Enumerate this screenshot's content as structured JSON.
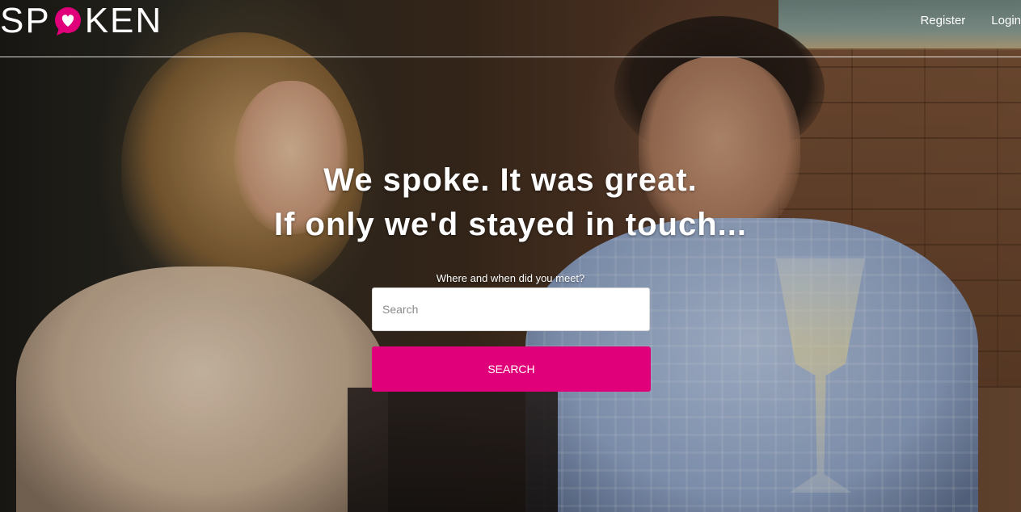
{
  "brand": {
    "logo_left": "SP",
    "logo_right": "KEN",
    "logo_text": "SPOKEN",
    "accent_color": "#e0007a"
  },
  "nav": {
    "register_label": "Register",
    "login_label": "Login"
  },
  "hero": {
    "title_line1": "We spoke. It was great.",
    "title_line2": "If only we'd stayed in touch...",
    "background_image": "photo-of-couple-with-wine-glasses"
  },
  "search": {
    "label": "Where and when did you meet?",
    "placeholder": "Search",
    "value": "",
    "button_label": "SEARCH"
  }
}
